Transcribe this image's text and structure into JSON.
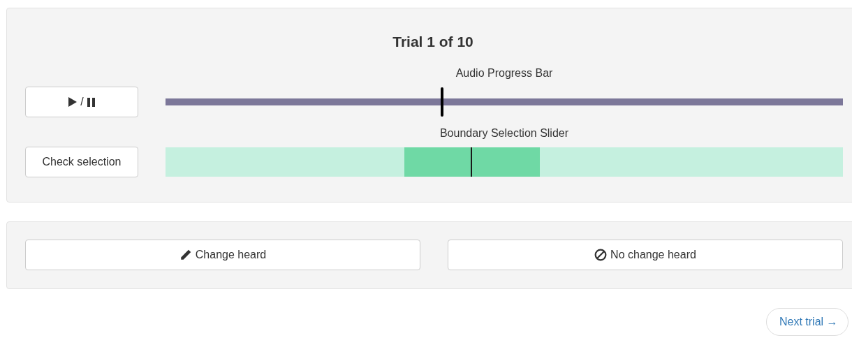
{
  "trial": {
    "title": "Trial 1 of 10",
    "play_button": {
      "separator": "/"
    },
    "progress": {
      "label": "Audio Progress Bar",
      "level": 0.408
    },
    "check_button": {
      "label": "Check selection"
    },
    "boundary_slider": {
      "label": "Boundary Selection Slider",
      "level": 0.452,
      "selection_end": {
        "level": 0.553
      },
      "selection_start": {
        "level": 0.353
      }
    }
  },
  "responses": [
    {
      "kind": "change",
      "label": "Change heard"
    },
    {
      "kind": "no_change",
      "label": "No change heard"
    }
  ],
  "next_button": {
    "label": "Next trial →"
  }
}
